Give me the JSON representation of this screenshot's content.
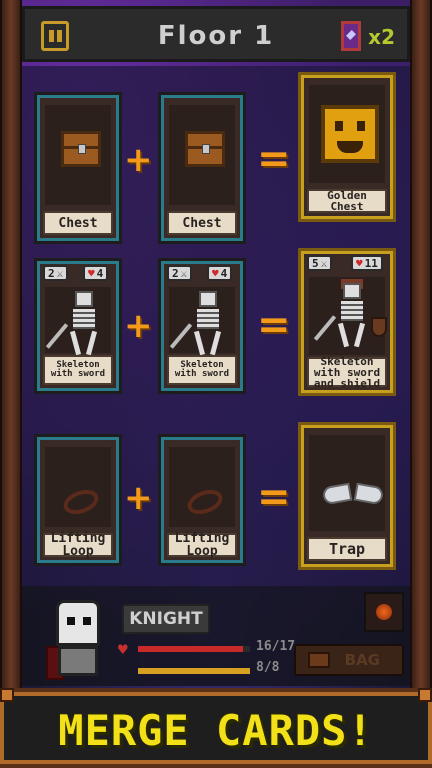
{
  "header": {
    "title": "Floor 1",
    "scroll_count": "x2"
  },
  "merges": [
    {
      "left": {
        "name": "Chest"
      },
      "right": {
        "name": "Chest"
      },
      "result": {
        "name": "Golden Chest"
      }
    },
    {
      "left": {
        "name": "Skeleton with sword",
        "attack": "2",
        "health": "4"
      },
      "right": {
        "name": "Skeleton with sword",
        "attack": "2",
        "health": "4"
      },
      "result": {
        "name": "Skeleton with sword and shield",
        "attack": "5",
        "health": "11"
      }
    },
    {
      "left": {
        "name": "Lifting Loop"
      },
      "right": {
        "name": "Lifting Loop"
      },
      "result": {
        "name": "Trap"
      }
    }
  ],
  "operators": {
    "plus": "+",
    "equals": "="
  },
  "hero": {
    "name": "KNIGHT",
    "hp_text": "16/17",
    "hp_fraction": 0.94,
    "xp_text": "8/8",
    "xp_fraction": 1.0
  },
  "inventory": {
    "bag_label": "BAG"
  },
  "banner": {
    "text": "MERGE CARDS!"
  },
  "colors": {
    "accent_orange": "#f39a1a",
    "card_rare_border": "#2a7c8c",
    "card_result_border": "#c8a020",
    "banner_text": "#f2e018"
  }
}
